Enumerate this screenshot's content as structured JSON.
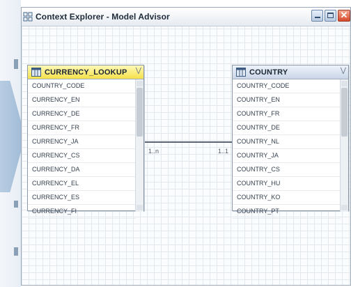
{
  "window": {
    "title": "Context Explorer - Model Advisor",
    "close_glyph": "✕"
  },
  "entities": [
    {
      "name": "CURRENCY_LOOKUP",
      "header_color": "#f5e14a",
      "columns": [
        "COUNTRY_CODE",
        "CURRENCY_EN",
        "CURRENCY_DE",
        "CURRENCY_FR",
        "CURRENCY_JA",
        "CURRENCY_CS",
        "CURRENCY_DA",
        "CURRENCY_EL",
        "CURRENCY_ES",
        "CURRENCY_FI"
      ]
    },
    {
      "name": "COUNTRY",
      "header_color": "#c9d6e8",
      "columns": [
        "COUNTRY_CODE",
        "COUNTRY_EN",
        "COUNTRY_FR",
        "COUNTRY_DE",
        "COUNTRY_NL",
        "COUNTRY_JA",
        "COUNTRY_CS",
        "COUNTRY_HU",
        "COUNTRY_KO",
        "COUNTRY_PT"
      ]
    }
  ],
  "relationship": {
    "left_cardinality": "1..n",
    "right_cardinality": "1..1"
  },
  "icons": {
    "app": "grid-icon",
    "table": "table-icon",
    "collapse": "double-chevron-icon"
  }
}
